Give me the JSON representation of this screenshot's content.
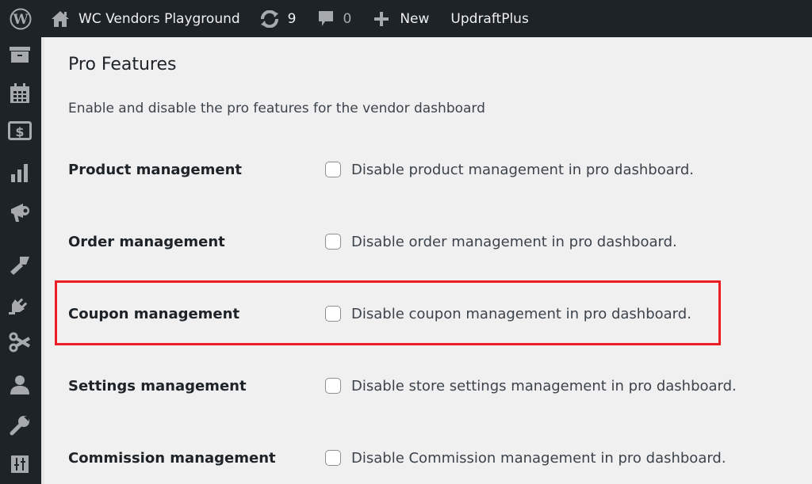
{
  "adminbar": {
    "site_name": "WC Vendors Playground",
    "updates_count": "9",
    "comments_count": "0",
    "new_label": "New",
    "plugin_link": "UpdraftPlus"
  },
  "sidebar": {
    "icons": [
      "archive-icon",
      "calendar-icon",
      "money-icon",
      "chart-icon",
      "megaphone-icon",
      "brush-icon",
      "plugin-icon",
      "scissors-icon",
      "user-icon",
      "wrench-icon",
      "settings-sliders-icon"
    ]
  },
  "page": {
    "title": "Pro Features",
    "description": "Enable and disable the pro features for the vendor dashboard"
  },
  "features": [
    {
      "label": "Product management",
      "option": "Disable product management in pro dashboard.",
      "checked": false
    },
    {
      "label": "Order management",
      "option": "Disable order management in pro dashboard.",
      "checked": false
    },
    {
      "label": "Coupon management",
      "option": "Disable coupon management in pro dashboard.",
      "checked": false,
      "highlighted": true
    },
    {
      "label": "Settings management",
      "option": "Disable store settings management in pro dashboard.",
      "checked": false
    },
    {
      "label": "Commission management",
      "option": "Disable Commission management in pro dashboard.",
      "checked": false
    }
  ],
  "colors": {
    "adminbar_bg": "#1d2327",
    "page_bg": "#f0f0f1",
    "highlight_border": "#ee1c25"
  }
}
